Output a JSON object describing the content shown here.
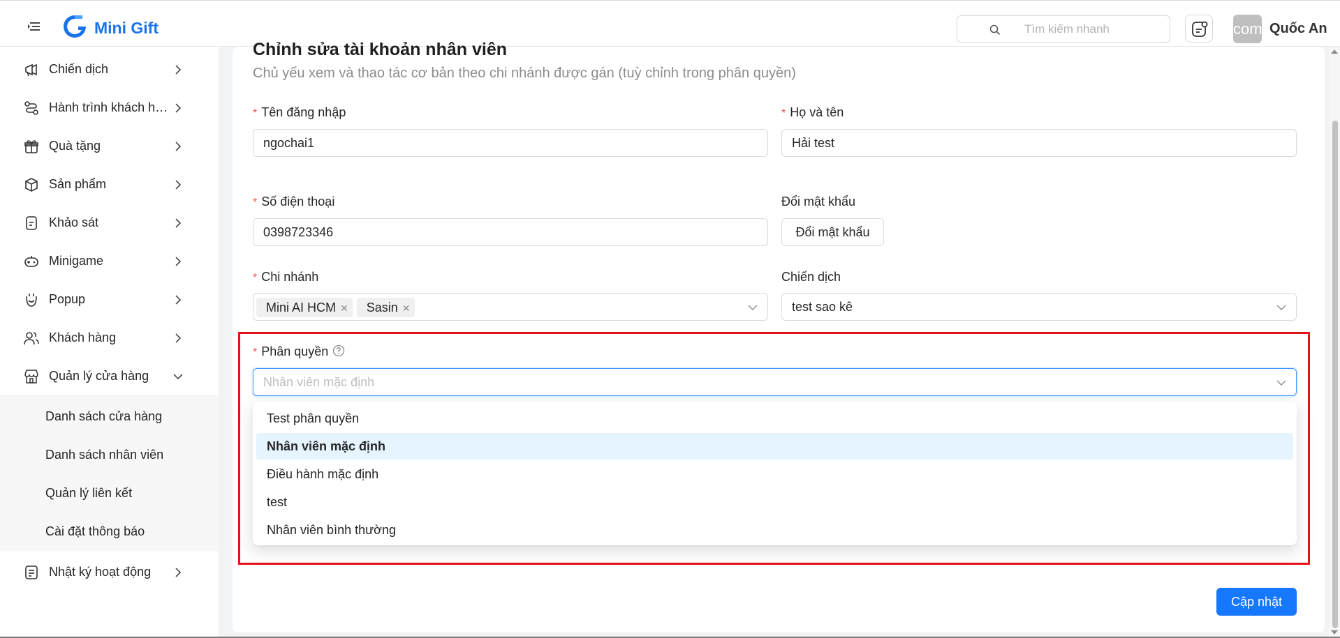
{
  "header": {
    "logo_text": "Mini Gift",
    "search_placeholder": "Tìm kiếm nhanh",
    "avatar_text": "com",
    "user_name": "Quốc An"
  },
  "sidebar": {
    "items": [
      {
        "label": "Chiến dịch",
        "icon": "megaphone-icon"
      },
      {
        "label": "Hành trình khách hàng",
        "icon": "route-icon"
      },
      {
        "label": "Quà tặng",
        "icon": "gift-icon"
      },
      {
        "label": "Sản phẩm",
        "icon": "box-icon"
      },
      {
        "label": "Khảo sát",
        "icon": "survey-icon"
      },
      {
        "label": "Minigame",
        "icon": "gamepad-icon"
      },
      {
        "label": "Popup",
        "icon": "popup-icon"
      },
      {
        "label": "Khách hàng",
        "icon": "users-icon"
      },
      {
        "label": "Quản lý cửa hàng",
        "icon": "store-icon"
      }
    ],
    "submenu": [
      "Danh sách cửa hàng",
      "Danh sách nhân viên",
      "Quản lý liên kết",
      "Cài đặt thông báo"
    ],
    "last_item": {
      "label": "Nhật ký hoạt động",
      "icon": "log-icon"
    }
  },
  "form": {
    "title": "Chỉnh sửa tài khoản nhân viên",
    "subtitle": "Chủ yếu xem và thao tác cơ bản theo chi nhánh được gán (tuỳ chỉnh trong phân quyền)",
    "required_mark": "*",
    "username_label": "Tên đăng nhập",
    "username_value": "ngochai1",
    "fullname_label": "Họ và tên",
    "fullname_value": "Hải test",
    "phone_label": "Số điện thoại",
    "phone_value": "0398723346",
    "password_label": "Đổi mật khẩu",
    "password_button": "Đổi mật khẩu",
    "branch_label": "Chi nhánh",
    "branch_tags": [
      "Mini AI HCM",
      "Sasin"
    ],
    "campaign_label": "Chiến dịch",
    "campaign_value": "test sao kê",
    "permission_label": "Phân quyền",
    "permission_placeholder": "Nhân viên mặc định",
    "permission_options": [
      "Test phân quyền",
      "Nhân viên mặc định",
      "Điều hành mặc định",
      "test",
      "Nhân viên bình thường"
    ],
    "permission_active_index": 1,
    "update_button": "Cập nhật"
  },
  "colors": {
    "brand": "#1a73e8",
    "primary": "#1677ff",
    "required": "#ff4d4f",
    "highlight": "#e8111a"
  }
}
